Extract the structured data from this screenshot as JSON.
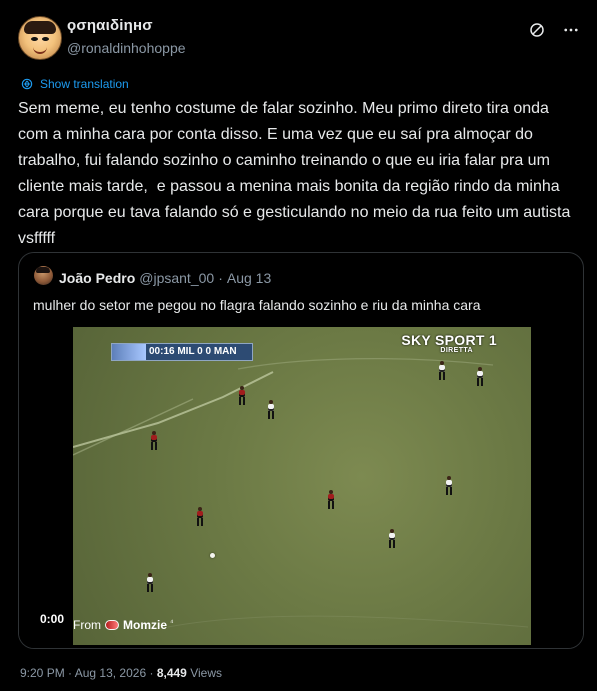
{
  "tweet": {
    "author": {
      "name": "ϙσηαιδiηнσ",
      "handle": "@ronaldinhohoppe",
      "avatar_icon": "cartoon-face-avatar"
    },
    "actions": {
      "grok_icon": "slash-circle-icon",
      "more_icon": "more-horizontal-icon"
    },
    "translation": {
      "label": "Show translation",
      "icon": "translate-icon"
    },
    "text": "Sem meme, eu tenho costume de falar sozinho. Meu primo direto tira onda com a minha cara por conta disso. E uma vez que eu saí pra almoçar do trabalho, fui falando sozinho o caminho treinando o que eu iria falar pra um cliente mais tarde,  e passou a menina mais bonita da região rindo da minha cara porque eu tava falando só e gesticulando no meio da rua feito um autista vsfffff",
    "meta": {
      "time": "9:20 PM",
      "separator": "·",
      "date": "Aug 13, 2026",
      "views_count": "8,449",
      "views_label": "Views"
    }
  },
  "quoted_tweet": {
    "author": {
      "name": "João Pedro",
      "handle": "@jpsant_00",
      "separator": "·",
      "date": "Aug 13"
    },
    "text": "mulher do setor me pegou no flagra falando sozinho e riu da minha cara",
    "video": {
      "scorebug": "00:16  MIL  0 0  MAN",
      "broadcaster": "SKY SPORT 1",
      "broadcaster_sub": "DIRETTA",
      "time": "0:00",
      "from_label": "From",
      "from_name": "Momzie",
      "from_badge": "⁴"
    }
  },
  "colors": {
    "background": "#000000",
    "text": "#e7e9ea",
    "muted": "#8b98a5",
    "accent": "#1d9bf0",
    "border": "#2f3336"
  }
}
